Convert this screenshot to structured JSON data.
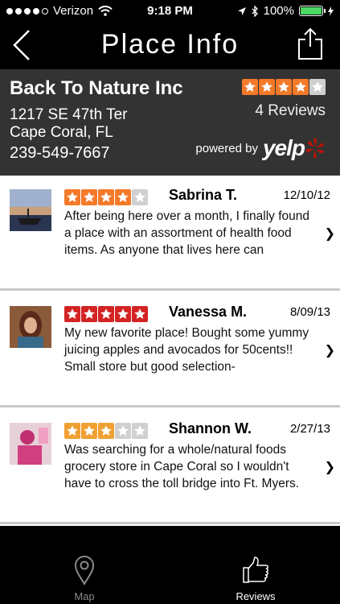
{
  "status_bar": {
    "carrier": "Verizon",
    "time": "9:18 PM",
    "battery_percent": "100%",
    "signal_bars": 4,
    "signal_total": 5
  },
  "nav": {
    "title": "Place Info"
  },
  "business": {
    "name": "Back To Nature Inc",
    "address_line1": "1217 SE 47th Ter",
    "address_line2": "Cape Coral, FL",
    "phone": "239-549-7667",
    "rating": 4,
    "reviews_count": "4 Reviews",
    "powered_by": "powered by",
    "yelp_logo_text": "yelp"
  },
  "reviews": [
    {
      "author": "Sabrina T.",
      "date": "12/10/12",
      "rating": 4,
      "text": "After being here over a month, I finally found a place with an assortment of health food items.  As anyone that lives here can"
    },
    {
      "author": "Vanessa M.",
      "date": "8/09/13",
      "rating": 5,
      "text": "My new favorite place! Bought some yummy juicing apples and avocados for 50cents!! Small store but good selection-"
    },
    {
      "author": "Shannon W.",
      "date": "2/27/13",
      "rating": 3,
      "text": "Was searching for a whole/natural foods grocery store in Cape Coral so I wouldn't have to cross the toll bridge into Ft. Myers."
    }
  ],
  "tabs": [
    {
      "label": "Map",
      "icon": "map-pin-icon",
      "selected": false
    },
    {
      "label": "Reviews",
      "icon": "thumbs-up-icon",
      "selected": true
    }
  ],
  "colors": {
    "star_header": "#f47a2a",
    "star_4": "#f47a2a",
    "star_5": "#d32323",
    "star_3": "#f0a032",
    "star_empty": "#d0d0d0",
    "yelp_red": "#c41200",
    "battery_green": "#4cd964"
  }
}
